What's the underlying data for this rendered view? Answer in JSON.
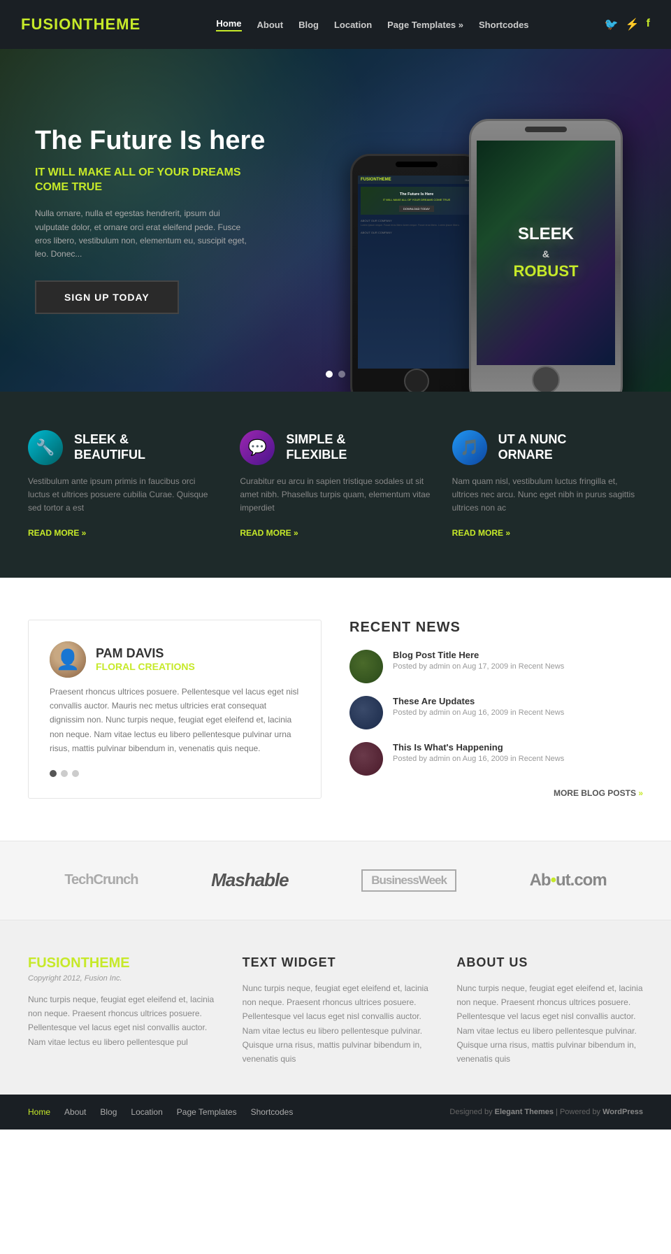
{
  "header": {
    "logo_part1": "FUSION",
    "logo_part2": "THEME",
    "nav_items": [
      {
        "label": "Home",
        "active": true
      },
      {
        "label": "About"
      },
      {
        "label": "Blog"
      },
      {
        "label": "Location"
      },
      {
        "label": "Page Templates »"
      },
      {
        "label": "Shortcodes"
      }
    ],
    "social": [
      {
        "icon": "🐦",
        "name": "twitter"
      },
      {
        "icon": "⚡",
        "name": "rss"
      },
      {
        "icon": "f",
        "name": "facebook"
      }
    ]
  },
  "hero": {
    "title": "The Future Is here",
    "subtitle": "IT WILL MAKE ALL OF YOUR DREAMS COME TRUE",
    "body": "Nulla ornare, nulla et egestas hendrerit, ipsum dui vulputate dolor, et ornare orci erat eleifend pede. Fusce eros libero, vestibulum non, elementum eu, suscipit eget, leo. Donec...",
    "cta": "SIGN UP TODAY",
    "phone_left_text": "The Future Is Here",
    "phone_right_line1": "SLEEK",
    "phone_right_line2": "&",
    "phone_right_line3": "ROBUST",
    "dots": [
      "active",
      "inactive"
    ]
  },
  "features": [
    {
      "title": "SLEEK &\nBEAUTIFUL",
      "icon": "🔧",
      "icon_class": "icon-teal",
      "desc": "Vestibulum ante ipsum primis in faucibus orci luctus et ultrices posuere cubilia Curae. Quisque sed tortor a est",
      "read_more": "READ MORE »"
    },
    {
      "title": "SIMPLE &\nFLEXIBLE",
      "icon": "💬",
      "icon_class": "icon-purple",
      "desc": "Curabitur eu arcu in sapien tristique sodales ut sit amet nibh. Phasellus turpis quam, elementum vitae imperdiet",
      "read_more": "READ MORE »"
    },
    {
      "title": "UT A NUNC\nORNARE",
      "icon": "🎵",
      "icon_class": "icon-blue",
      "desc": "Nam quam nisl, vestibulum luctus fringilla et, ultrices nec arcu. Nunc eget nibh in purus sagittis ultrices non ac",
      "read_more": "READ MORE »"
    }
  ],
  "testimonial": {
    "author_name": "PAM DAVIS",
    "author_subtitle": "FLORAL CREATIONS",
    "text": "Praesent rhoncus ultrices posuere. Pellentesque vel lacus eget nisl convallis auctor. Mauris nec metus ultricies erat consequat dignissim non. Nunc turpis neque, feugiat eget eleifend et, lacinia non neque. Nam vitae lectus eu libero pellentesque pulvinar urna risus, mattis pulvinar bibendum in, venenatis quis neque.",
    "dots": [
      "active",
      "inactive",
      "inactive"
    ]
  },
  "recent_news": {
    "section_title": "RECENT NEWS",
    "items": [
      {
        "title": "Blog Post Title Here",
        "meta": "Posted by admin on Aug 17, 2009 in Recent News",
        "thumb_class": "news-thumb-1"
      },
      {
        "title": "These Are Updates",
        "meta": "Posted by admin on Aug 16, 2009 in Recent News",
        "thumb_class": "news-thumb-2"
      },
      {
        "title": "This Is What's Happening",
        "meta": "Posted by admin on Aug 16, 2009 in Recent News",
        "thumb_class": "news-thumb-3"
      }
    ],
    "more_label": "MORE BLOG POSTS »"
  },
  "logos": [
    {
      "label": "TechCrunch",
      "class": "tech"
    },
    {
      "label": "Mashable",
      "class": "mash"
    },
    {
      "label": "BusinessWeek",
      "class": "bw"
    },
    {
      "label": "Ab•ut.com",
      "class": "about"
    }
  ],
  "footer_widgets": {
    "logo_part1": "FUSION",
    "logo_part2": "THEME",
    "copyright": "Copyright 2012, Fusion Inc.",
    "body_text": "Nunc turpis neque, feugiat eget eleifend et, lacinia non neque. Praesent rhoncus ultrices posuere. Pellentesque vel lacus eget nisl convallis auctor. Nam vitae lectus eu libero pellentesque pul",
    "text_widget_title": "TEXT WIDGET",
    "text_widget_body": "Nunc turpis neque, feugiat eget eleifend et, lacinia non neque. Praesent rhoncus ultrices posuere. Pellentesque vel lacus eget nisl convallis auctor. Nam vitae lectus eu libero pellentesque pulvinar. Quisque urna risus, mattis pulvinar bibendum in, venenatis quis",
    "about_title": "ABOUT US",
    "about_body": "Nunc turpis neque, feugiat eget eleifend et, lacinia non neque. Praesent rhoncus ultrices posuere. Pellentesque vel lacus eget nisl convallis auctor. Nam vitae lectus eu libero pellentesque pulvinar. Quisque urna risus, mattis pulvinar bibendum in, venenatis quis"
  },
  "footer_nav": {
    "links": [
      {
        "label": "Home",
        "active": true
      },
      {
        "label": "About"
      },
      {
        "label": "Blog"
      },
      {
        "label": "Location"
      },
      {
        "label": "Page Templates"
      },
      {
        "label": "Shortcodes"
      }
    ],
    "credit": "Designed by Elegant Themes | Powered by WordPress"
  }
}
